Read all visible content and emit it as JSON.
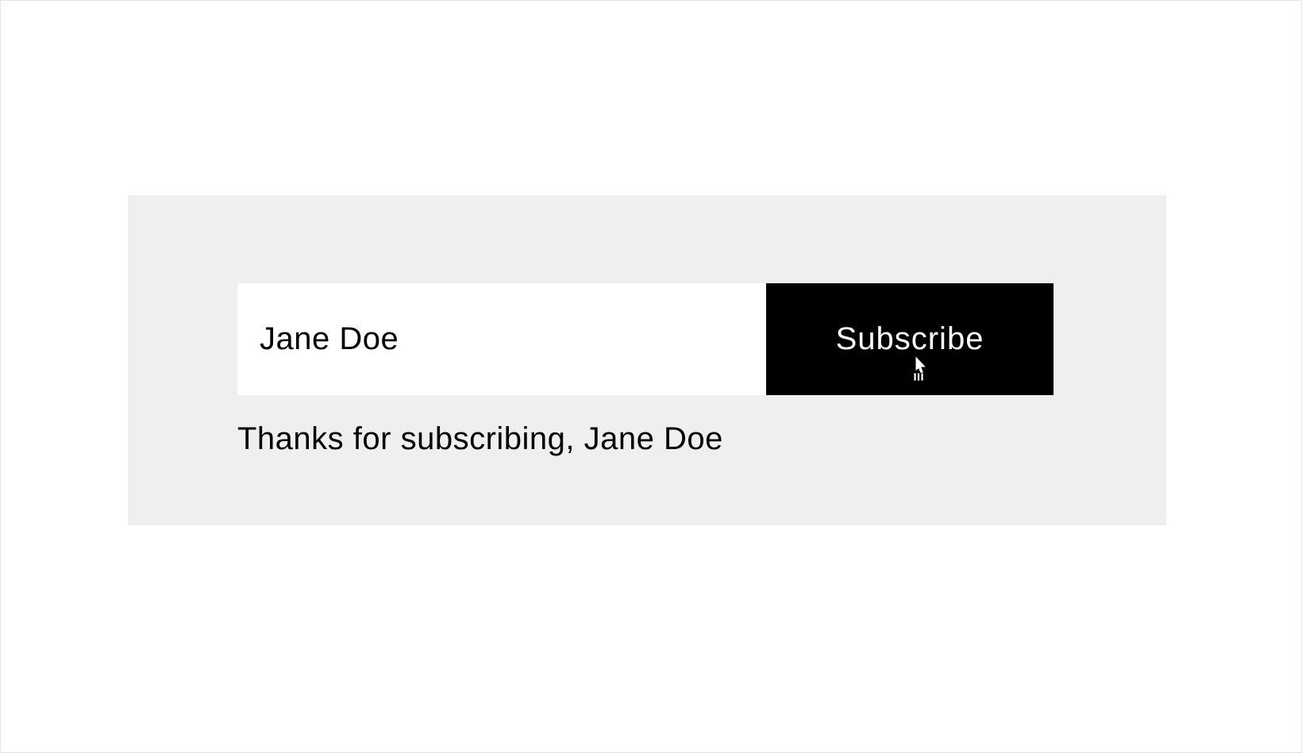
{
  "form": {
    "name_value": "Jane Doe",
    "subscribe_label": "Subscribe"
  },
  "confirmation": {
    "message": "Thanks for subscribing, Jane Doe"
  }
}
